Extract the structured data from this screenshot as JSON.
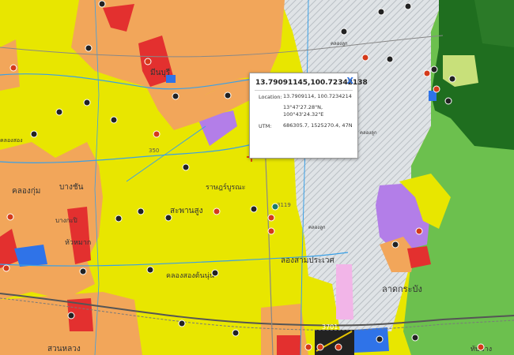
{
  "popup": {
    "title": "13.79091145,100.72342138",
    "close_label": "X",
    "location_label": "Location:",
    "location_value": "13.7909114, 100.7234214",
    "dms_lat": "13°47'27.28\"N,",
    "dms_lon": "100°43'24.32\"E",
    "utm_label": "UTM:",
    "utm_value": "686305.7, 1525270.4, 47N"
  },
  "map": {
    "labels": {
      "khlong_sam_prawet": "ลองสามประเวศ",
      "lat_krabang": "ลาดกระบัง",
      "khlong_luk_1": "คลองลูก",
      "khlong_luk_2": "คลองลูก",
      "khlong_luk_3": "คลองลูก",
      "khlong_song": "คลองสอง",
      "sai_mai": "สวนหลวง",
      "min_buri": "มีนบุรี",
      "bang_chan": "บางชัน",
      "khlong_kum": "คลองกุ่ม",
      "phraya_suren": "สะพานสูง",
      "rat_burana": "ราษฎร์บูรณะ",
      "thap_chang": "ทับช้าง",
      "hua_mak": "หัวหมาก",
      "saphan_sung": "คลองสองต้นนุ่น",
      "bang_kapi": "บางกะปิ",
      "road_3701": "3701",
      "road_3119": "3119",
      "road_350": "350"
    },
    "colors": {
      "yellow_zone": "#e8e600",
      "orange_zone": "#f2a65a",
      "red_zone": "#e3302f",
      "purple_zone": "#b37ee8",
      "light_green_zone": "#69c04e",
      "dark_green_zone": "#1f6e1f",
      "grey_hatched_zone": "#d9dde0",
      "blue_zone": "#2f73e8",
      "pink_zone": "#f0b0e0",
      "marker_cross": "#e01010"
    }
  }
}
